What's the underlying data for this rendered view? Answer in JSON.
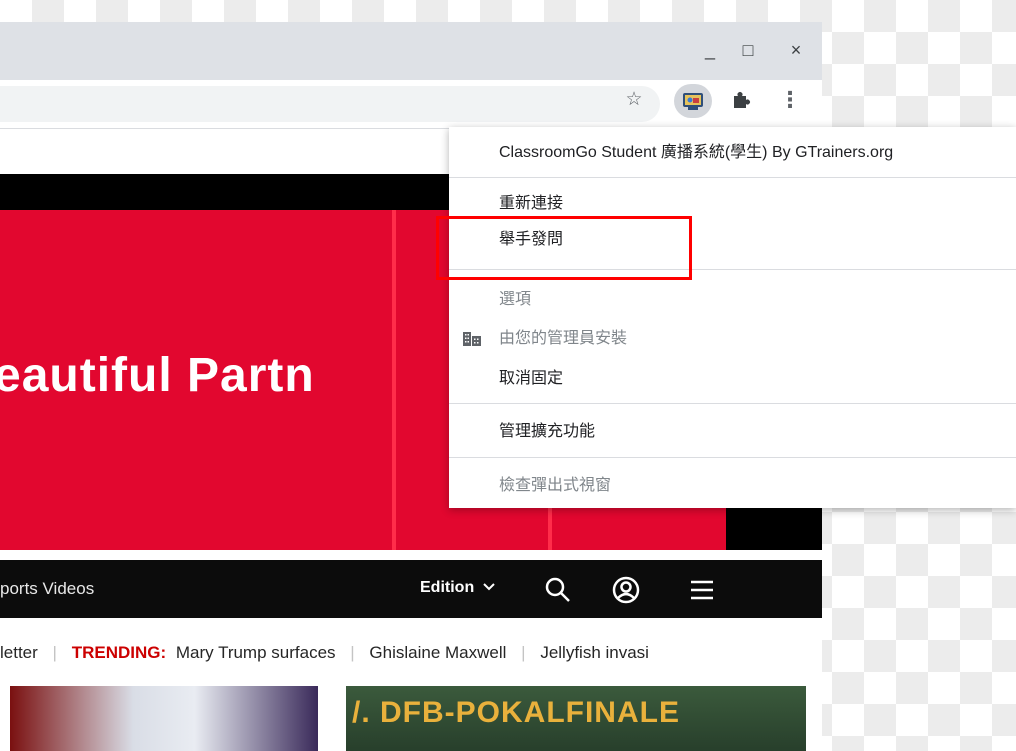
{
  "window": {
    "minimize_label": "_",
    "maximize_label": "□",
    "close_label": "×"
  },
  "toolbar": {
    "bookmark_icon": "star-icon",
    "extension_icon": "classroomgo-extension-icon",
    "extensions_icon": "puzzle-icon",
    "menu_icon": "kebab-menu-icon"
  },
  "page": {
    "hero_text": "eautiful Partn",
    "nav_links": "ports  Videos",
    "edition_label": "Edition",
    "trending": {
      "item_newsletter": "letter",
      "label": "TRENDING:",
      "item_1": "Mary Trump surfaces",
      "item_2": "Ghislaine Maxwell",
      "item_3": "Jellyfish invasi"
    },
    "thumb2_text": "/. DFB-POKALFINALE"
  },
  "context_menu": {
    "header": "ClassroomGo Student 廣播系統(學生) By GTrainers.org",
    "items": [
      {
        "label": "重新連接"
      },
      {
        "label": "舉手發問"
      },
      {
        "label": "選項"
      },
      {
        "label": "由您的管理員安裝"
      },
      {
        "label": "取消固定"
      },
      {
        "label": "管理擴充功能"
      },
      {
        "label": "檢查彈出式視窗"
      }
    ]
  },
  "colors": {
    "hero_red": "#e2072f",
    "highlight_red": "#ff0000",
    "trending_red": "#cc0000"
  }
}
